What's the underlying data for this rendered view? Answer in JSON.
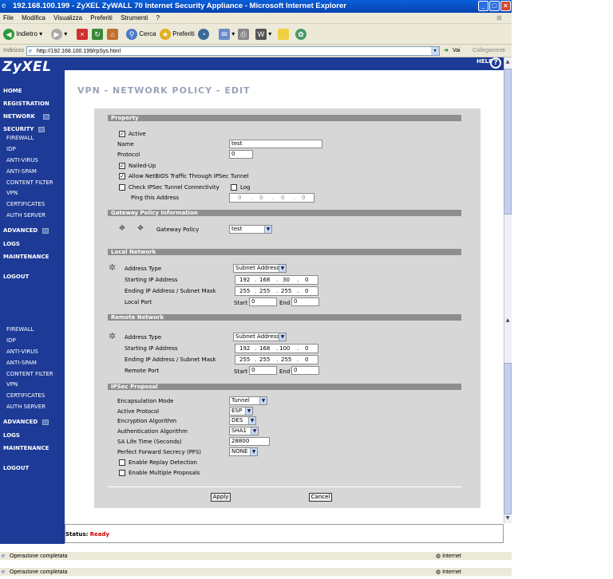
{
  "window": {
    "title": "192.168.100.199 - ZyXEL ZyWALL 70 Internet Security Appliance - Microsoft Internet Explorer"
  },
  "menubar": [
    "File",
    "Modifica",
    "Visualizza",
    "Preferiti",
    "Strumenti",
    "?"
  ],
  "toolbar": {
    "back": "Indietro",
    "search": "Cerca",
    "favorites": "Preferiti"
  },
  "address": {
    "label": "Indirizzo",
    "url": "http://192.168.100.199/rpSys.html",
    "go": "Vai",
    "links": "Collegamenti"
  },
  "brand": {
    "logo": "ZyXEL",
    "help": "HELP"
  },
  "sidebar_top": {
    "home": "HOME",
    "registration": "REGISTRATION",
    "network": "NETWORK",
    "security": "SECURITY",
    "sub": [
      "FIREWALL",
      "IDP",
      "ANTI-VIRUS",
      "ANTI-SPAM",
      "CONTENT FILTER",
      "VPN",
      "CERTIFICATES",
      "AUTH SERVER"
    ],
    "advanced": "ADVANCED",
    "logs": "LOGS",
    "maintenance": "MAINTENANCE",
    "logout": "LOGOUT"
  },
  "sidebar_bottom": {
    "sub": [
      "FIREWALL",
      "IDP",
      "ANTI-VIRUS",
      "ANTI-SPAM",
      "CONTENT FILTER",
      "VPN",
      "CERTIFICATES",
      "AUTH SERVER"
    ],
    "advanced": "ADVANCED",
    "logs": "LOGS",
    "maintenance": "MAINTENANCE",
    "logout": "LOGOUT"
  },
  "page": {
    "title": "VPN - NETWORK POLICY - EDIT"
  },
  "property": {
    "header": "Property",
    "active_label": "Active",
    "name_label": "Name",
    "name_value": "test",
    "protocol_label": "Protocol",
    "protocol_value": "0",
    "nailed_up_label": "Nailed-Up",
    "netbios_label": "Allow NetBIOS Traffic Through IPSec Tunnel",
    "check_conn_label": "Check IPSec Tunnel Connectivity",
    "log_label": "Log",
    "ping_label": "Ping this Address",
    "ping_ip": [
      "0",
      "0",
      "0",
      "0"
    ]
  },
  "gateway": {
    "header": "Gateway Policy Information",
    "policy_label": "Gateway Policy",
    "policy_value": "test"
  },
  "local": {
    "header": "Local Network",
    "addr_type_label": "Address Type",
    "addr_type_value": "Subnet Address",
    "start_label": "Starting IP Address",
    "start_ip": [
      "192",
      "168",
      "30",
      "0"
    ],
    "end_label": "Ending IP Address / Subnet Mask",
    "end_ip": [
      "255",
      "255",
      "255",
      "0"
    ],
    "port_label": "Local Port",
    "start_port_label": "Start",
    "start_port": "0",
    "end_port_label": "End",
    "end_port": "0"
  },
  "remote": {
    "header": "Remote Network",
    "addr_type_label": "Address Type",
    "addr_type_value": "Subnet Address",
    "start_label": "Starting IP Address",
    "start_ip": [
      "192",
      "168",
      "100",
      "0"
    ],
    "end_label": "Ending IP Address / Subnet Mask",
    "end_ip": [
      "255",
      "255",
      "255",
      "0"
    ],
    "port_label": "Remote Port",
    "start_port_label": "Start",
    "start_port": "0",
    "end_port_label": "End",
    "end_port": "0"
  },
  "ipsec": {
    "header": "IPSec Proposal",
    "encap_label": "Encapsulation Mode",
    "encap_value": "Tunnel",
    "proto_label": "Active Protocol",
    "proto_value": "ESP",
    "enc_label": "Encryption Algorithm",
    "enc_value": "DES",
    "auth_label": "Authentication Algorithm",
    "auth_value": "SHA1",
    "sa_label": "SA Life Time (Seconds)",
    "sa_value": "28800",
    "pfs_label": "Perfect Forward Secrecy (PFS)",
    "pfs_value": "NONE",
    "replay_label": "Enable Replay Detection",
    "multi_label": "Enable Multiple Proposals"
  },
  "buttons": {
    "apply": "Apply",
    "cancel": "Cancel"
  },
  "status": {
    "label": "Status:",
    "value": "Ready"
  },
  "iestatus": {
    "text": "Operazione completata",
    "zone": "Internet"
  },
  "colors": {
    "sidebar": "#1c3a96",
    "status_ready": "#cc0000"
  }
}
